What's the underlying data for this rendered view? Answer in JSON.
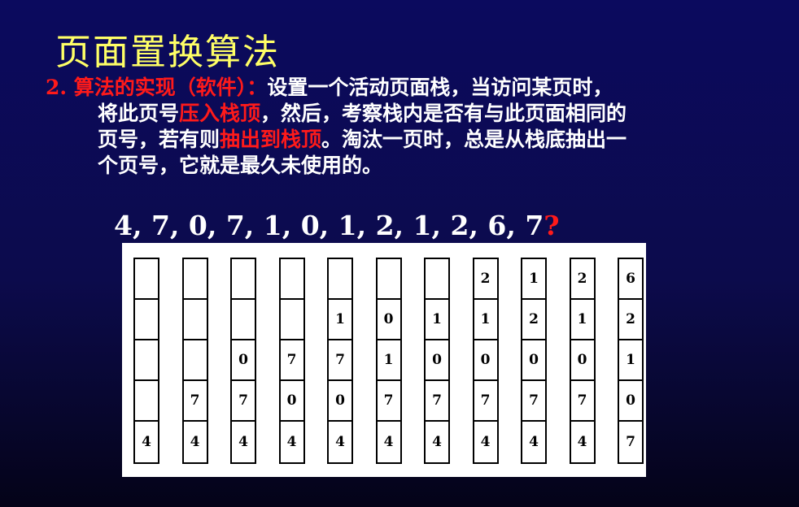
{
  "title": "页面置换算法",
  "paragraph": {
    "heading": "2. 算法的实现（软件）：",
    "line1_rest": "设置一个活动页面栈，当访问某页时，",
    "line2_a": "将此页号",
    "line2_red": "压入栈顶",
    "line2_b": "，然后，考察栈内是否有与此页面相同的",
    "line3_a": "页号，若有则",
    "line3_red": "抽出到栈顶",
    "line3_b": "。淘汰一页时，总是从栈底抽出一",
    "line4": "个页号，它就是最久未使用的。"
  },
  "sequence": {
    "text": "4, 7, 0, 7, 1, 0, 1, 2, 1, 2, 6, 7",
    "question": "?"
  },
  "stacks": [
    [
      "",
      "",
      "",
      "",
      "4"
    ],
    [
      "",
      "",
      "",
      "7",
      "4"
    ],
    [
      "",
      "",
      "0",
      "7",
      "4"
    ],
    [
      "",
      "",
      "7",
      "0",
      "4"
    ],
    [
      "",
      "1",
      "7",
      "0",
      "4"
    ],
    [
      "",
      "0",
      "1",
      "7",
      "4"
    ],
    [
      "",
      "1",
      "0",
      "7",
      "4"
    ],
    [
      "2",
      "1",
      "0",
      "7",
      "4"
    ],
    [
      "1",
      "2",
      "0",
      "7",
      "4"
    ],
    [
      "2",
      "1",
      "0",
      "7",
      "4"
    ],
    [
      "6",
      "2",
      "1",
      "0",
      "7"
    ]
  ]
}
